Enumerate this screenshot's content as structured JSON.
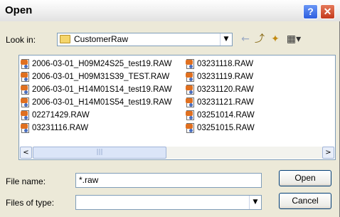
{
  "window": {
    "title": "Open",
    "help_glyph": "?",
    "close_glyph": "✕"
  },
  "lookin": {
    "label": "Look in:",
    "folder": "CustomerRaw",
    "folder_icon": "folder-icon"
  },
  "toolbar": {
    "back_glyph": "←",
    "up_glyph": "⤴",
    "new_folder_glyph": "✦",
    "views_glyph": "▦▾"
  },
  "files": {
    "left": [
      "2006-03-01_H09M24S25_test19.RAW",
      "2006-03-01_H09M31S39_TEST.RAW",
      "2006-03-01_H14M01S14_test19.RAW",
      "2006-03-01_H14M01S54_test19.RAW",
      "02271429.RAW",
      "03231116.RAW"
    ],
    "right": [
      "03231118.RAW",
      "03231119.RAW",
      "03231120.RAW",
      "03231121.RAW",
      "03251014.RAW",
      "03251015.RAW"
    ],
    "icon": "raw-file-icon"
  },
  "scroll": {
    "left_glyph": "<",
    "right_glyph": ">",
    "grip": "|||"
  },
  "filename": {
    "label": "File name:",
    "value": "*.raw"
  },
  "filetype": {
    "label": "Files of type:",
    "value": ""
  },
  "buttons": {
    "open": "Open",
    "cancel": "Cancel"
  }
}
